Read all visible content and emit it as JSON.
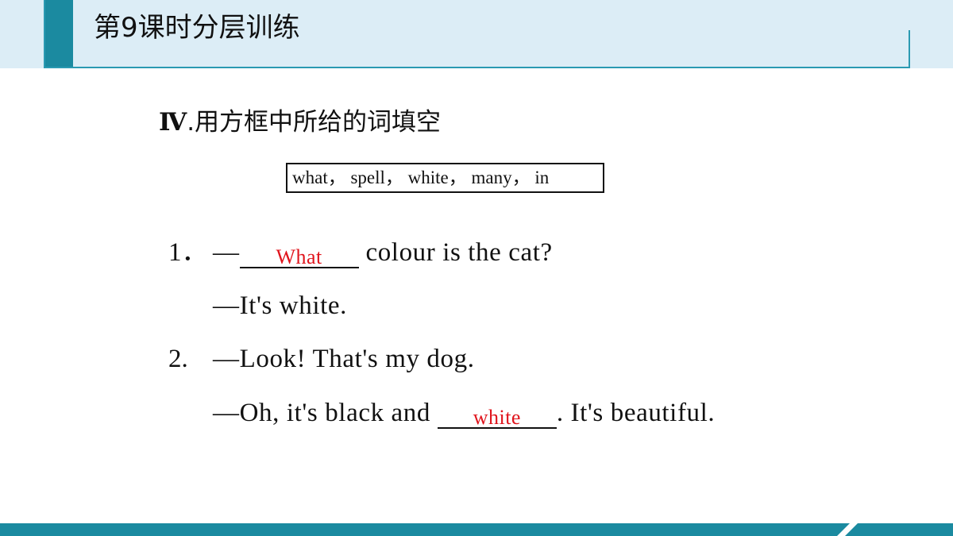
{
  "header": {
    "title": "第9课时分层训练"
  },
  "section": {
    "numeral": "Ⅳ",
    "heading": ".用方框中所给的词填空"
  },
  "word_box": {
    "text": "what， spell， white， many， in"
  },
  "items": [
    {
      "number": "1．",
      "prefix": "—",
      "answer": "What",
      "suffix": " colour is the cat?",
      "reply": "—It's white."
    },
    {
      "number": "2.",
      "line": "—Look! That's my dog.",
      "reply_prefix": "—Oh, it's black and ",
      "answer": "white",
      "reply_suffix": ". It's beautiful."
    }
  ],
  "colors": {
    "accent": "#1b8aa0",
    "header_bg": "#dcedf6",
    "answer": "#e0141c"
  }
}
